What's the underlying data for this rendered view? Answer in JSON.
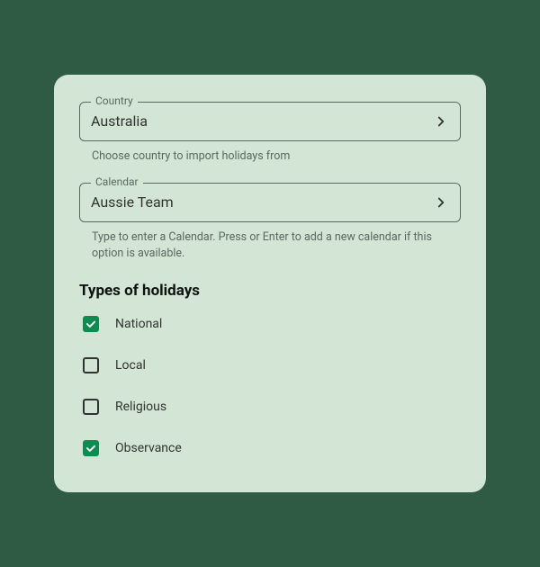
{
  "country": {
    "label": "Country",
    "value": "Australia",
    "helper": "Choose country to import holidays from"
  },
  "calendar": {
    "label": "Calendar",
    "value": "Aussie Team",
    "helper": "Type to enter a Calendar. Press or Enter to add a new calendar if this option is available."
  },
  "types_heading": "Types of holidays",
  "types": [
    {
      "label": "National",
      "checked": true
    },
    {
      "label": "Local",
      "checked": false
    },
    {
      "label": "Religious",
      "checked": false
    },
    {
      "label": "Observance",
      "checked": true
    }
  ]
}
